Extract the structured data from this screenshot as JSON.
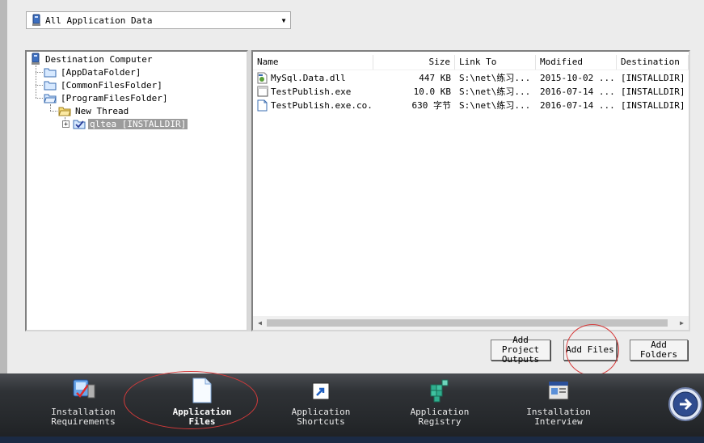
{
  "dropdown": {
    "selected": "All Application Data",
    "icon": "computer-icon"
  },
  "tree": {
    "root": "Destination Computer",
    "folders": [
      "[AppDataFolder]",
      "[CommonFilesFolder]",
      "[ProgramFilesFolder]"
    ],
    "subfolder": "New Thread",
    "project": "qltea [INSTALLDIR]"
  },
  "file_list": {
    "columns": [
      "Name",
      "Size",
      "Link To",
      "Modified",
      "Destination"
    ],
    "rows": [
      {
        "icon": "dll-icon",
        "name": "MySql.Data.dll",
        "size": "447 KB",
        "link_to": "S:\\net\\练习...",
        "modified": "2015-10-02 ...",
        "destination": "[INSTALLDIR]"
      },
      {
        "icon": "exe-icon",
        "name": "TestPublish.exe",
        "size": "10.0 KB",
        "link_to": "S:\\net\\练习...",
        "modified": "2016-07-14 ...",
        "destination": "[INSTALLDIR]"
      },
      {
        "icon": "config-file-icon",
        "name": "TestPublish.exe.co...",
        "size": "630 字节",
        "link_to": "S:\\net\\练习...",
        "modified": "2016-07-14 ...",
        "destination": "[INSTALLDIR]"
      }
    ]
  },
  "buttons": {
    "add_project_outputs": "Add Project\nOutputs",
    "add_files": "Add Files",
    "add_folders": "Add Folders"
  },
  "nav": [
    {
      "label": "Installation\nRequirements",
      "icon": "installation-requirements-icon",
      "active": false
    },
    {
      "label": "Application\nFiles",
      "icon": "application-files-icon",
      "active": true
    },
    {
      "label": "Application\nShortcuts",
      "icon": "application-shortcuts-icon",
      "active": false
    },
    {
      "label": "Application\nRegistry",
      "icon": "application-registry-icon",
      "active": false
    },
    {
      "label": "Installation\nInterview",
      "icon": "installation-interview-icon",
      "active": false
    }
  ],
  "colors": {
    "annotation_circle": "#d63b3b",
    "selected_node": "#9c9c9c",
    "bottom_bar": "#2f3236"
  }
}
